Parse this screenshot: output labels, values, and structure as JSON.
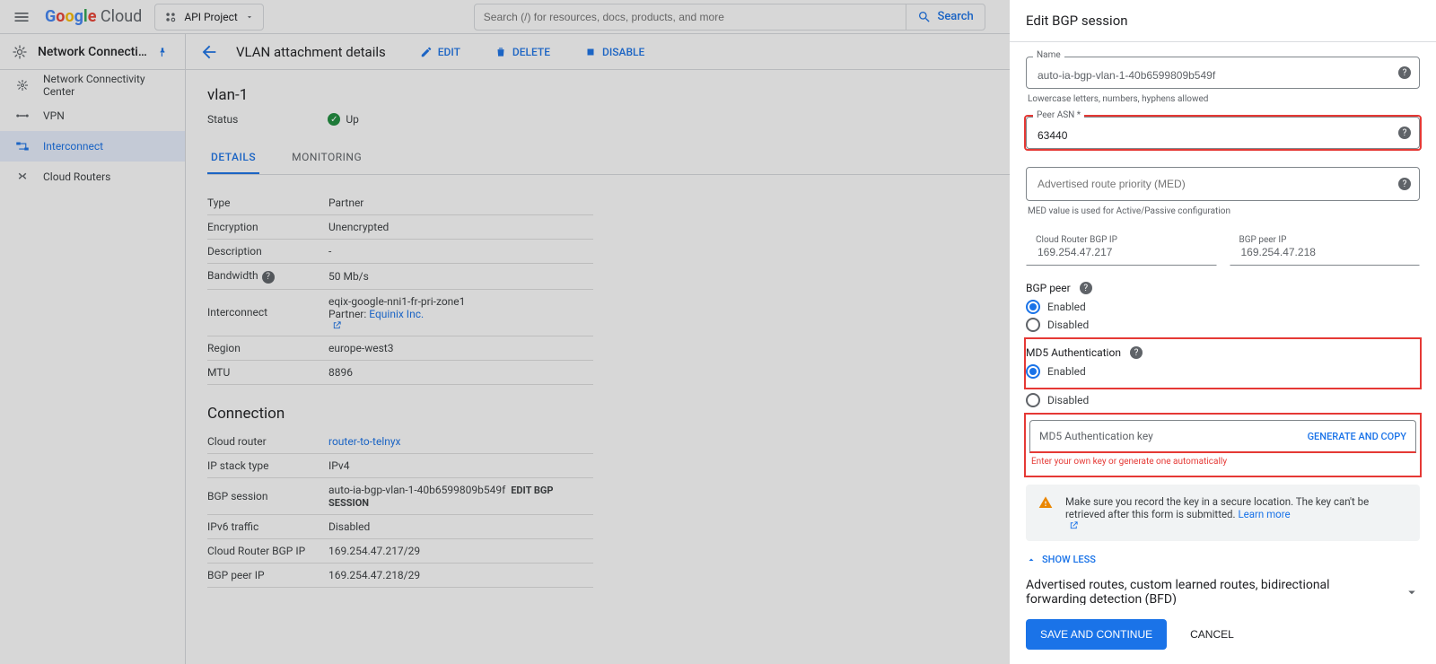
{
  "topbar": {
    "logo_cloud": "Cloud",
    "project_label": "API Project",
    "search_placeholder": "Search (/) for resources, docs, products, and more",
    "search_button": "Search"
  },
  "section": {
    "product_title": "Network Connecti…",
    "page_title": "VLAN attachment details",
    "actions": {
      "edit": "EDIT",
      "delete": "DELETE",
      "disable": "DISABLE"
    }
  },
  "sidebar": {
    "items": [
      {
        "label": "Network Connectivity Center"
      },
      {
        "label": "VPN"
      },
      {
        "label": "Interconnect"
      },
      {
        "label": "Cloud Routers"
      }
    ]
  },
  "details": {
    "name": "vlan-1",
    "status_label": "Status",
    "status_value": "Up",
    "tabs": {
      "details": "DETAILS",
      "monitoring": "MONITORING"
    },
    "rows": {
      "type_k": "Type",
      "type_v": "Partner",
      "enc_k": "Encryption",
      "enc_v": "Unencrypted",
      "desc_k": "Description",
      "desc_v": "-",
      "bw_k": "Bandwidth",
      "bw_v": "50 Mb/s",
      "ic_k": "Interconnect",
      "ic_v": "eqix-google-nni1-fr-pri-zone1",
      "ic_partner_label": "Partner:",
      "ic_partner": "Equinix Inc.",
      "region_k": "Region",
      "region_v": "europe-west3",
      "mtu_k": "MTU",
      "mtu_v": "8896"
    },
    "connection_h": "Connection",
    "conn": {
      "cr_k": "Cloud router",
      "cr_v": "router-to-telnyx",
      "ip_k": "IP stack type",
      "ip_v": "IPv4",
      "bgp_k": "BGP session",
      "bgp_v": "auto-ia-bgp-vlan-1-40b6599809b549f",
      "bgp_edit": "EDIT BGP SESSION",
      "v6_k": "IPv6 traffic",
      "v6_v": "Disabled",
      "crip_k": "Cloud Router BGP IP",
      "crip_v": "169.254.47.217/29",
      "peerip_k": "BGP peer IP",
      "peerip_v": "169.254.47.218/29"
    }
  },
  "panel": {
    "title": "Edit BGP session",
    "name_label": "Name",
    "name_value": "auto-ia-bgp-vlan-1-40b6599809b549f",
    "name_helper": "Lowercase letters, numbers, hyphens allowed",
    "peer_asn_label": "Peer ASN *",
    "peer_asn_value": "63440",
    "med_label": "Advertised route priority (MED)",
    "med_helper": "MED value is used for Active/Passive configuration",
    "cr_bgp_ip_label": "Cloud Router BGP IP",
    "cr_bgp_ip_value": "169.254.47.217",
    "bgp_peer_ip_label": "BGP peer IP",
    "bgp_peer_ip_value": "169.254.47.218",
    "bgp_peer_group": "BGP peer",
    "enabled": "Enabled",
    "disabled": "Disabled",
    "md5_group": "MD5 Authentication",
    "md5_key_label": "MD5 Authentication key",
    "md5_generate": "GENERATE AND COPY",
    "md5_err": "Enter your own key or generate one automatically",
    "info_text": "Make sure you record the key in a secure location. The key can't be retrieved after this form is submitted. ",
    "info_link": "Learn more",
    "show_less": "SHOW LESS",
    "expander": "Advertised routes, custom learned routes, bidirectional forwarding detection (BFD)",
    "save": "SAVE AND CONTINUE",
    "cancel": "CANCEL"
  }
}
